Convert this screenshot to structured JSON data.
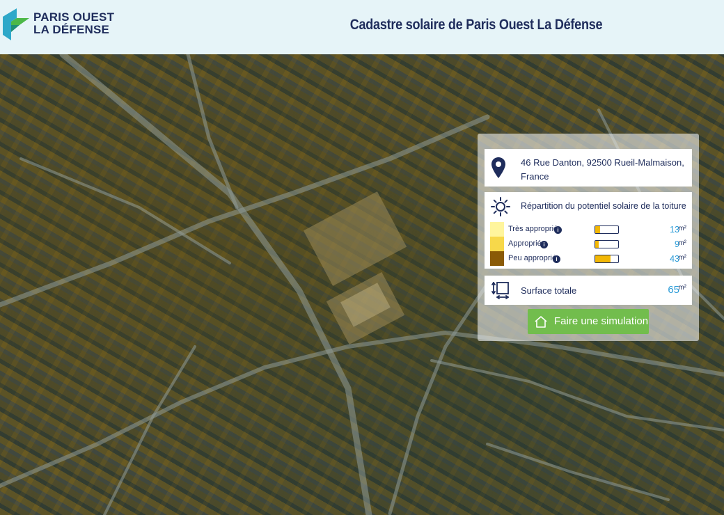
{
  "header": {
    "logo_line1": "PARIS OUEST",
    "logo_line2": "LA DÉFENSE",
    "title": "Cadastre solaire de Paris Ouest La Défense"
  },
  "panel": {
    "address_line1": "46 Rue Danton, 92500 Rueil-Malmaison,",
    "address_line2": "France",
    "solar_title": "Répartition du potentiel solaire de la toiture",
    "rows": [
      {
        "label": "Très approprié",
        "value": "13",
        "unit": "m²",
        "color": "#fff59d",
        "fill": 0.2
      },
      {
        "label": "Approprié",
        "value": "9",
        "unit": "m²",
        "color": "#f7d84a",
        "fill": 0.14
      },
      {
        "label": "Peu approprié",
        "value": "43",
        "unit": "m²",
        "color": "#8a5a06",
        "fill": 0.66
      }
    ],
    "total_label": "Surface totale",
    "total_value": "65",
    "total_unit": "m²",
    "button_label": "Faire une simulation"
  },
  "colors": {
    "navy": "#1f2d5c",
    "accent_blue": "#2a9bd7",
    "button_green": "#72bd4d",
    "bar_yellow": "#f2b705"
  },
  "icons": [
    "logo-icon",
    "map-pin-icon",
    "sun-icon",
    "ruler-area-icon",
    "info-icon",
    "home-icon"
  ]
}
